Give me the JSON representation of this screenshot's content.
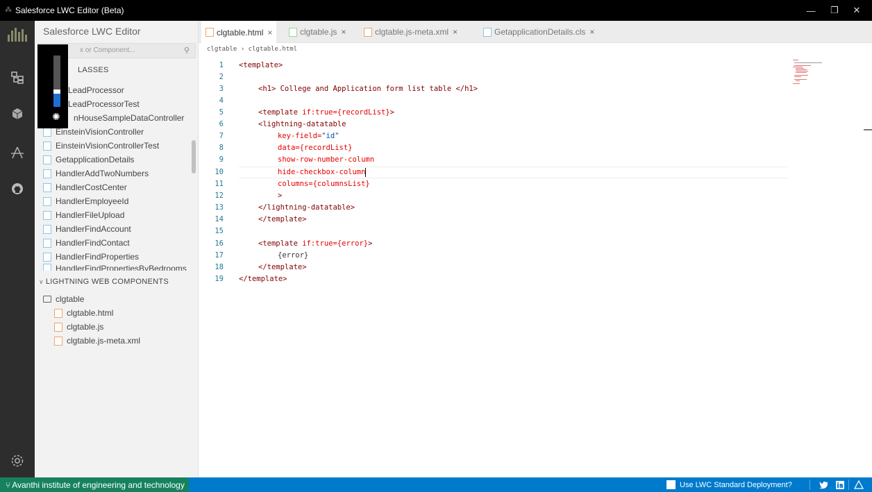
{
  "window": {
    "title": "Salesforce LWC Editor (Beta)",
    "controls": {
      "minimize": "—",
      "restore": "❐",
      "close": "✕"
    }
  },
  "activity_bar": {
    "icons": [
      "logo-icon",
      "explorer-icon",
      "cube-icon",
      "trailhead-icon",
      "github-icon",
      "settings-icon"
    ]
  },
  "brightness_overlay": {
    "level_fraction": 0.3
  },
  "sidebar": {
    "title": "Salesforce LWC Editor",
    "search_placeholder": "x or Component...",
    "apex_section": "LASSES",
    "apex_items": [
      "LeadProcessor",
      "LeadProcessorTest",
      "nHouseSampleDataController",
      "EinsteinVisionController",
      "EinsteinVisionControllerTest",
      "GetapplicationDetails",
      "HandlerAddTwoNumbers",
      "HandlerCostCenter",
      "HandlerEmployeeId",
      "HandlerFileUpload",
      "HandlerFindAccount",
      "HandlerFindContact",
      "HandlerFindProperties",
      "HandlerFindPropertiesByBedrooms"
    ],
    "lwc_section": "LIGHTNING WEB COMPONENTS",
    "lwc_folder": "clgtable",
    "lwc_files": [
      "clgtable.html",
      "clgtable.js",
      "clgtable.js-meta.xml"
    ]
  },
  "tabs": [
    {
      "label": "clgtable.html",
      "active": true,
      "icon": "orange"
    },
    {
      "label": "clgtable.js",
      "active": false,
      "icon": "green"
    },
    {
      "label": "clgtable.js-meta.xml",
      "active": false,
      "icon": "orange"
    },
    {
      "label": "GetapplicationDetails.cls",
      "active": false,
      "icon": "blue"
    }
  ],
  "tab_close": "×",
  "breadcrumb": {
    "folder": "clgtable",
    "sep": "›",
    "file": "clgtable.html"
  },
  "editor": {
    "line_numbers": [
      "1",
      "2",
      "3",
      "4",
      "5",
      "6",
      "7",
      "8",
      "9",
      "10",
      "11",
      "12",
      "13",
      "14",
      "15",
      "16",
      "17",
      "18",
      "19"
    ],
    "l1": "<template>",
    "l3": "<h1> College and Application form list table </h1>",
    "l5_tag": "<template ",
    "l5_attr": "if:true=",
    "l5_val": "{recordList}",
    "l5_end": ">",
    "l6": "<lightning-datatable",
    "l7_attr": "key-field=",
    "l7_val": "\"id\"",
    "l8_attr": "data=",
    "l8_val": "{recordList}",
    "l9": "show-row-number-column",
    "l10": "hide-checkbox-column",
    "l11_attr": "columns=",
    "l11_val": "{columnsList}",
    "l12": ">",
    "l13": "</lightning-datatable>",
    "l14": "</template>",
    "l16_tag": "<template ",
    "l16_attr": "if:true=",
    "l16_val": "{error}",
    "l16_end": ">",
    "l17": "{error}",
    "l18": "</template>",
    "l19": "</template>"
  },
  "status": {
    "branch_icon": "⑂",
    "branch": "Avanthi institute of engineering and technology",
    "deploy_label": "Use LWC Standard Deployment?",
    "icons": [
      "twitter-icon",
      "linkedin-icon",
      "warning-icon"
    ]
  }
}
